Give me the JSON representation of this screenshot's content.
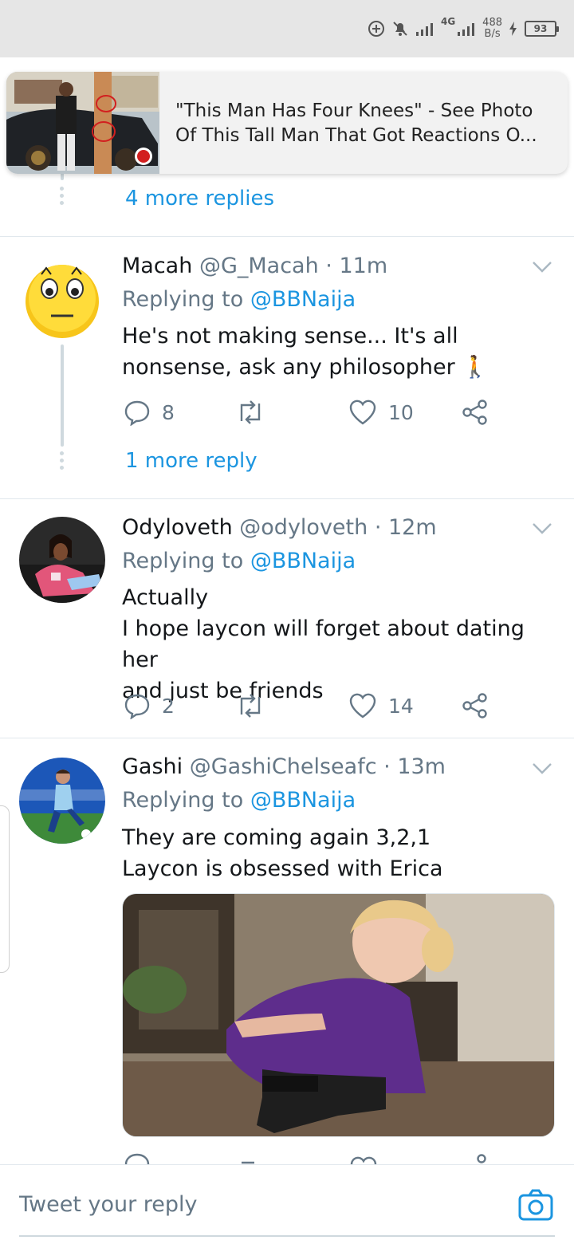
{
  "status_bar": {
    "network": "4G",
    "speed_value": "488",
    "speed_unit": "B/s",
    "battery": "93"
  },
  "notification": {
    "headline": "\"This Man Has Four Knees\" - See Photo Of This Tall Man That Got Reactions O..."
  },
  "thread": {
    "top_more_replies": "4 more replies"
  },
  "tweets": [
    {
      "name": "Macah",
      "handle": "@G_Macah",
      "time": "· 11m",
      "replying_prefix": "Replying to",
      "replying_to": "@BBNaija",
      "text_lines": [
        "He's not making sense... It's all",
        "nonsense, ask any philosopher 🚶"
      ],
      "replies": "8",
      "retweets": "",
      "likes": "10",
      "more_replies": "1 more reply"
    },
    {
      "name": "Odyloveth",
      "handle": "@odyloveth",
      "time": "· 12m",
      "replying_prefix": "Replying to",
      "replying_to": "@BBNaija",
      "text_lines": [
        "Actually",
        "I hope laycon will forget about dating her",
        "and just be friends"
      ],
      "replies": "2",
      "retweets": "",
      "likes": "14"
    },
    {
      "name": "Gashi",
      "handle": "@GashiChelseafc",
      "time": "· 13m",
      "replying_prefix": "Replying to",
      "replying_to": "@BBNaija",
      "text_lines": [
        "They are coming again 3,2,1",
        "Laycon is obsessed with Erica"
      ]
    }
  ],
  "reply_bar": {
    "placeholder": "Tweet your reply"
  },
  "colors": {
    "link": "#1b95e0",
    "muted": "#657786",
    "divider": "#e1e8ed"
  }
}
